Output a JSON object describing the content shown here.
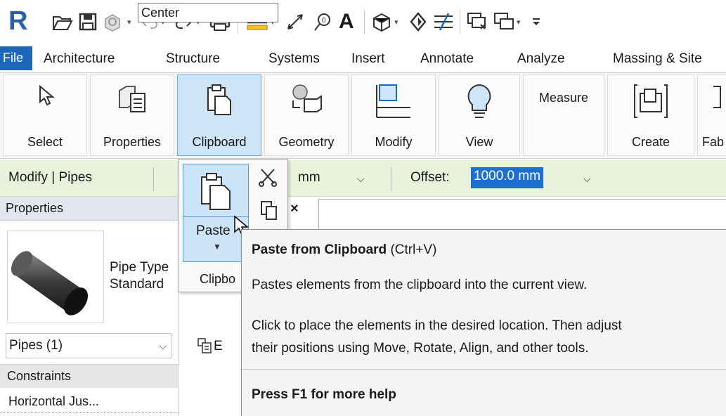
{
  "app": {
    "logo_letter": "R",
    "accent": "#2b5fa8"
  },
  "qat": {
    "items": [
      {
        "name": "open-icon"
      },
      {
        "name": "save-icon"
      },
      {
        "name": "sync-icon"
      },
      {
        "name": "undo-icon"
      },
      {
        "name": "redo-icon"
      },
      {
        "name": "print-icon"
      },
      {
        "name": "measure-icon"
      },
      {
        "name": "dimension-icon"
      },
      {
        "name": "tag-icon"
      },
      {
        "name": "text-icon"
      },
      {
        "name": "3d-view-icon"
      },
      {
        "name": "section-icon"
      },
      {
        "name": "thin-lines-icon"
      },
      {
        "name": "close-windows-icon"
      },
      {
        "name": "switch-windows-icon"
      },
      {
        "name": "customize-icon"
      }
    ],
    "text_glyph": "A"
  },
  "menu": {
    "file": "File",
    "tabs": [
      "Architecture",
      "Structure",
      "Systems",
      "Insert",
      "Annotate",
      "Analyze",
      "Massing & Site"
    ]
  },
  "ribbon": {
    "buttons": [
      "Select",
      "Properties",
      "Clipboard",
      "Geometry",
      "Modify",
      "View",
      "Create",
      "Fab"
    ],
    "measure": "Measure"
  },
  "options_bar": {
    "context": "Modify | Pipes",
    "unit_partial": "mm",
    "offset_label": "Offset:",
    "offset_value": "1000.0 mm"
  },
  "properties": {
    "header": "Properties",
    "type_line1": "Pipe Type",
    "type_line2": "Standard",
    "selector": "Pipes (1)",
    "section": "Constraints",
    "row_label": "Horizontal Jus...",
    "row_value": "Center",
    "edit_letter": "E"
  },
  "clipboard_panel": {
    "paste": "Paste",
    "panel_label": "Clipbo"
  },
  "tooltip": {
    "title": "Paste from Clipboard",
    "shortcut": "(Ctrl+V)",
    "description": "Pastes elements from the clipboard into the current view.",
    "extra_line1": "Click to place the elements in the desired location. Then adjust",
    "extra_line2": "their positions using Move, Rotate, Align, and other tools.",
    "help": "Press F1 for more help"
  },
  "close_glyph": "×"
}
